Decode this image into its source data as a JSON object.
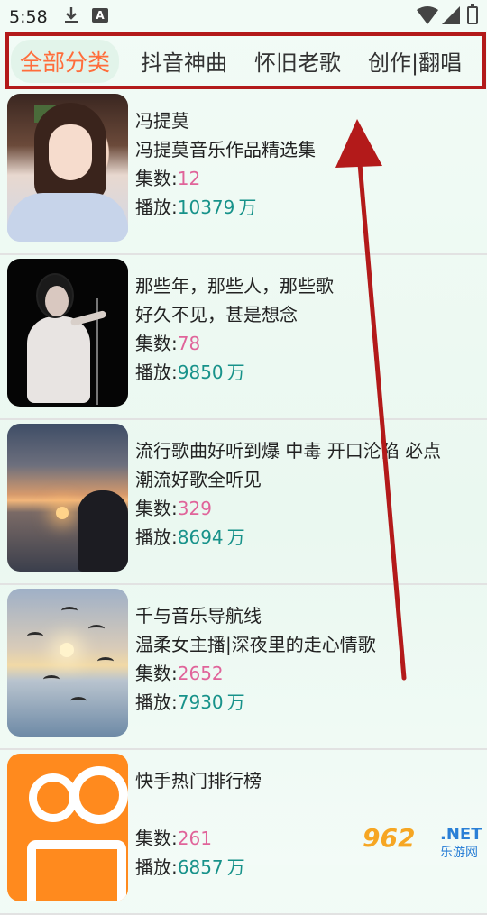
{
  "status_bar": {
    "time": "5:58",
    "notif_icon_letter": "A"
  },
  "tabs": [
    {
      "label": "全部分类",
      "active": true
    },
    {
      "label": "抖音神曲",
      "active": false
    },
    {
      "label": "怀旧老歌",
      "active": false
    },
    {
      "label": "创作|翻唱",
      "active": false
    }
  ],
  "labels": {
    "count_prefix": "集数:",
    "play_prefix": "播放:",
    "play_unit": "万"
  },
  "items": [
    {
      "title": "冯提莫",
      "subtitle": "冯提莫音乐作品精选集",
      "count": "12",
      "plays": "10379"
    },
    {
      "title": "那些年，那些人，那些歌",
      "subtitle": "好久不见，甚是想念",
      "count": "78",
      "plays": "9850"
    },
    {
      "title": "流行歌曲好听到爆 中毒 开口沦陷 必点",
      "subtitle": "潮流好歌全听见",
      "count": "329",
      "plays": "8694"
    },
    {
      "title": "千与音乐导航线",
      "subtitle": "温柔女主播|深夜里的走心情歌",
      "count": "2652",
      "plays": "7930"
    },
    {
      "title": "快手热门排行榜",
      "subtitle": "",
      "count": "261",
      "plays": "6857"
    }
  ],
  "watermark": {
    "logo": "962",
    "net": ".NET",
    "cn": "乐游网"
  },
  "colors": {
    "accent_tab": "#ff6d3b",
    "count_color": "#e0649a",
    "play_color": "#17928a",
    "highlight_border": "#b31a1a"
  }
}
